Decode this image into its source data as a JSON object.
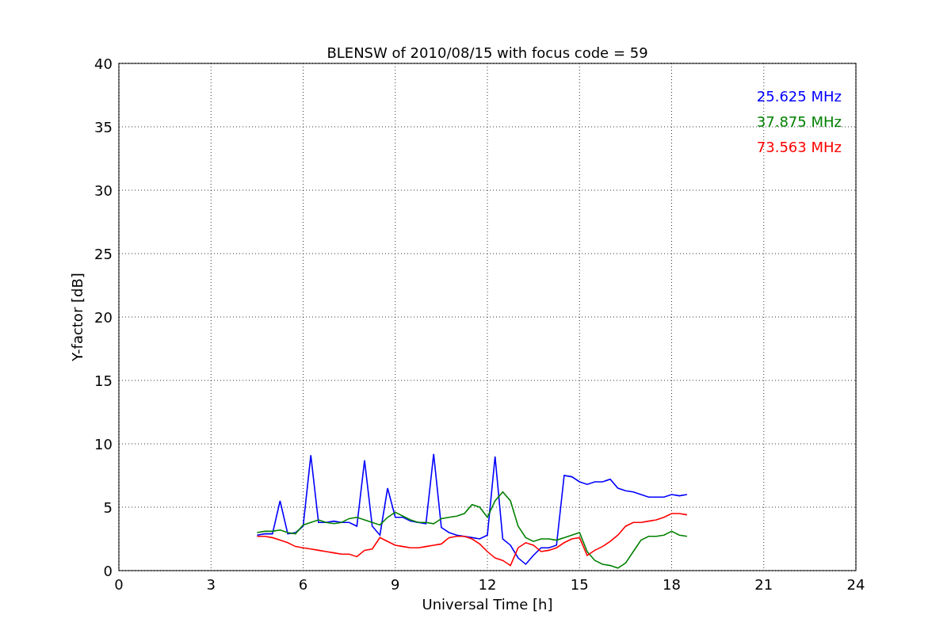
{
  "figure": {
    "chart_data": {
      "type": "line",
      "grid": true,
      "title": "BLENSW of 2010/08/15 with focus code = 59",
      "xlabel": "Universal Time [h]",
      "ylabel": "Y-factor [dB]",
      "xlim": [
        0,
        24
      ],
      "ylim": [
        0,
        40
      ],
      "xticks": [
        0,
        3,
        6,
        9,
        12,
        15,
        18,
        21,
        24
      ],
      "yticks": [
        0,
        5,
        10,
        15,
        20,
        25,
        30,
        35,
        40
      ],
      "x": [
        4.5,
        4.75,
        5,
        5.25,
        5.5,
        5.75,
        6,
        6.25,
        6.5,
        6.75,
        7,
        7.25,
        7.5,
        7.75,
        8,
        8.25,
        8.5,
        8.75,
        9,
        9.25,
        9.5,
        9.75,
        10,
        10.25,
        10.5,
        10.75,
        11,
        11.25,
        11.5,
        11.75,
        12,
        12.25,
        12.5,
        12.75,
        13,
        13.25,
        13.5,
        13.75,
        14,
        14.25,
        14.5,
        14.75,
        15,
        15.25,
        15.5,
        15.75,
        16,
        16.25,
        16.5,
        16.75,
        17,
        17.25,
        17.5,
        17.75,
        18,
        18.25,
        18.5
      ],
      "series": [
        {
          "name": "25.625 MHz",
          "color": "#0000ff",
          "values": [
            2.8,
            2.9,
            2.9,
            5.5,
            2.9,
            3.0,
            3.5,
            9.1,
            3.8,
            3.8,
            3.9,
            3.8,
            3.8,
            3.5,
            8.7,
            3.5,
            2.8,
            6.5,
            4.2,
            4.2,
            3.9,
            3.8,
            3.7,
            9.2,
            3.4,
            3.0,
            2.8,
            2.7,
            2.6,
            2.5,
            2.8,
            9.0,
            2.5,
            2.0,
            1.0,
            0.5,
            1.2,
            1.8,
            1.8,
            2.0,
            7.5,
            7.4,
            7.0,
            6.8,
            7.0,
            7.0,
            7.2,
            6.5,
            6.3,
            6.2,
            6.0,
            5.8,
            5.8,
            5.8,
            6.0,
            5.9,
            6.0
          ]
        },
        {
          "name": "37.875 MHz",
          "color": "#008000",
          "values": [
            3.0,
            3.1,
            3.1,
            3.2,
            3.0,
            2.9,
            3.6,
            3.8,
            4.0,
            3.8,
            3.7,
            3.8,
            4.1,
            4.2,
            4.0,
            3.8,
            3.6,
            4.2,
            4.6,
            4.3,
            4.0,
            3.8,
            3.8,
            3.7,
            4.1,
            4.2,
            4.3,
            4.5,
            5.2,
            5.0,
            4.2,
            5.5,
            6.2,
            5.5,
            3.5,
            2.6,
            2.3,
            2.5,
            2.5,
            2.4,
            2.6,
            2.8,
            3.0,
            1.5,
            0.8,
            0.5,
            0.4,
            0.2,
            0.6,
            1.5,
            2.4,
            2.7,
            2.7,
            2.8,
            3.1,
            2.8,
            2.7
          ]
        },
        {
          "name": "73.563 MHz",
          "color": "#ff0000",
          "values": [
            2.7,
            2.7,
            2.6,
            2.4,
            2.2,
            1.9,
            1.8,
            1.7,
            1.6,
            1.5,
            1.4,
            1.3,
            1.3,
            1.1,
            1.6,
            1.7,
            2.6,
            2.3,
            2.0,
            1.9,
            1.8,
            1.8,
            1.9,
            2.0,
            2.1,
            2.6,
            2.7,
            2.7,
            2.5,
            2.1,
            1.5,
            1.0,
            0.8,
            0.4,
            1.8,
            2.2,
            2.0,
            1.5,
            1.6,
            1.8,
            2.2,
            2.5,
            2.6,
            1.2,
            1.6,
            1.9,
            2.3,
            2.8,
            3.5,
            3.8,
            3.8,
            3.9,
            4.0,
            4.2,
            4.5,
            4.5,
            4.4
          ]
        }
      ]
    }
  }
}
